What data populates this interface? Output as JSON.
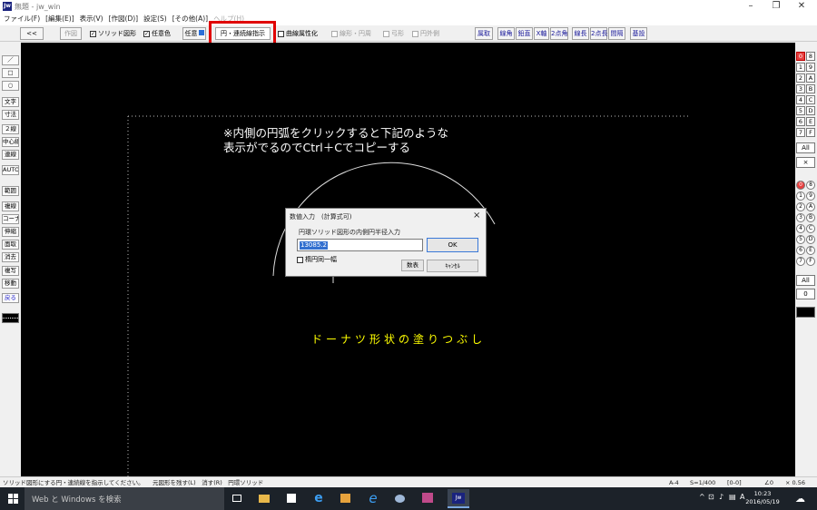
{
  "window": {
    "title": "無題 - jw_win",
    "icon_label": "Jw"
  },
  "menu": [
    "ファイル(F)",
    "[編集(E)]",
    "表示(V)",
    "[作図(D)]",
    "設定(S)",
    "[その他(A)]",
    "ヘルプ(H)"
  ],
  "toolbar": {
    "back": "<<",
    "sakuzu": "作図",
    "solid": "ソリッド図形",
    "anyColor": "任意色",
    "anyButton": "任意",
    "circleMode": "円・連続線指示",
    "curveAttr": "曲線属性化",
    "lineCircle": "線形・円周",
    "arc": "弓形",
    "circumference": "円外側",
    "buttons": [
      "属取",
      "線角",
      "鉛直",
      "X軸",
      "2点角",
      "線長",
      "2点長",
      "間隔",
      "基設"
    ]
  },
  "left_tools": [
    "／",
    "□",
    "○",
    "文字",
    "寸法",
    "２線",
    "中心線",
    "連線",
    "AUTO",
    "範囲",
    "複線",
    "コーナー",
    "伸縮",
    "面取",
    "消去",
    "複写",
    "移動",
    "戻る"
  ],
  "right_layers": {
    "row1": [
      [
        "0",
        "8"
      ],
      [
        "1",
        "9"
      ],
      [
        "2",
        "A"
      ],
      [
        "3",
        "B"
      ],
      [
        "4",
        "C"
      ],
      [
        "5",
        "D"
      ],
      [
        "6",
        "E"
      ],
      [
        "7",
        "F"
      ]
    ],
    "all": "All",
    "x": "×",
    "row2": [
      [
        "0",
        "8"
      ],
      [
        "1",
        "9"
      ],
      [
        "2",
        "A"
      ],
      [
        "3",
        "B"
      ],
      [
        "4",
        "C"
      ],
      [
        "5",
        "D"
      ],
      [
        "6",
        "E"
      ],
      [
        "7",
        "F"
      ]
    ],
    "all2": "All",
    "zero": "0"
  },
  "canvas": {
    "note_line1": "※内側の円弧をクリックすると下記のような",
    "note_line2": "表示がでるのでCtrl＋Cでコピーする",
    "caption": "ドーナツ形状の塗りつぶし"
  },
  "dialog": {
    "title": "数値入力　(計算式可)",
    "close": "×",
    "label": "円環ソリッド図形の内側円半径入力",
    "value": "13085.2",
    "ok": "OK",
    "same_width": "楕円同一幅",
    "calc": "数表",
    "cancel": "ｷｬﾝｾﾙ"
  },
  "status": {
    "message": "ソリッド図形にする円・連続線を指示してください。",
    "left_opts": "元図形を残す(L)　消す(R)　円環ソリッド",
    "paper": "A-4",
    "scale": "S=1/400",
    "layer": "[0-0]",
    "angle": "∠0",
    "zoom": "× 0.56"
  },
  "taskbar": {
    "search": "Web と Windows を検索",
    "time": "10:23",
    "date": "2016/05/19",
    "ime": "A"
  },
  "colors": {
    "canvas": "#000000",
    "note_text": "#ffffff",
    "caption": "#ffff00",
    "highlight": "#e00000",
    "taskbar": "#1c2229"
  }
}
